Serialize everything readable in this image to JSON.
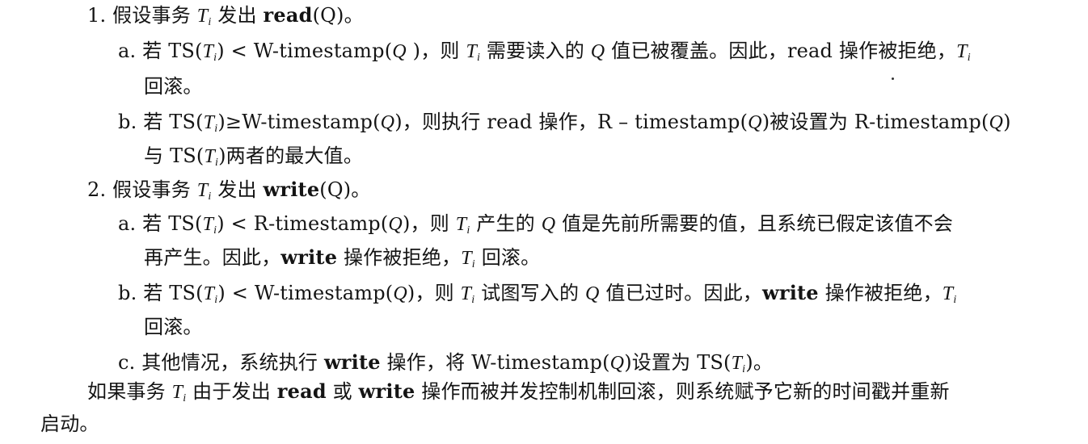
{
  "rules": {
    "r1": {
      "num": "1.",
      "p1": "假设事务 ",
      "T": "T",
      "i": "i",
      "p2": " 发出 ",
      "op": "read",
      "arg": "(Q)。"
    },
    "r1a": {
      "line1_p1": "a. 若 TS(",
      "line1_p2": ") < W-timestamp(",
      "line1_p3": " )，则 ",
      "line1_p4": " 需要读入的 ",
      "line1_p5": " 值已被覆盖。因此，read 操作被拒绝，",
      "line2": "回滚。"
    },
    "r1b": {
      "line1_p1": "b. 若 TS(",
      "line1_p2": ")≥W-timestamp(",
      "line1_p3": ")，则执行 read 操作，R – timestamp(",
      "line1_p4": ")被设置为 R-timestamp(",
      "line1_p5": ")",
      "line2_p1": "与 TS(",
      "line2_p2": ")两者的最大值。"
    },
    "r2": {
      "num": "2.",
      "p1": "假设事务 ",
      "p2": " 发出 ",
      "op": "write",
      "arg": "(Q)。"
    },
    "r2a": {
      "line1_p1": "a. 若 TS(",
      "line1_p2": ") < R-timestamp(",
      "line1_p3": ")，则 ",
      "line1_p4": " 产生的 ",
      "line1_p5": " 值是先前所需要的值，且系统已假定该值不会",
      "line2_p1": "再产生。因此，",
      "line2_op": "write",
      "line2_p2": " 操作被拒绝，",
      "line2_p3": " 回滚。"
    },
    "r2b": {
      "line1_p1": "b. 若 TS(",
      "line1_p2": ") < W-timestamp(",
      "line1_p3": ")，则 ",
      "line1_p4": " 试图写入的 ",
      "line1_p5": " 值已过时。因此，",
      "line1_op": "write",
      "line1_p6": " 操作被拒绝，",
      "line2": "回滚。"
    },
    "r2c": {
      "p1": "c. 其他情况，系统执行 ",
      "op": "write",
      "p2": " 操作，将 W-timestamp(",
      "p3": ")设置为 TS(",
      "p4": ")。"
    }
  },
  "closing": {
    "p1": "如果事务 ",
    "p2": " 由于发出 ",
    "op1": "read",
    "p3": " 或 ",
    "op2": "write",
    "p4": " 操作而被并发控制机制回滚，则系统赋予它新的时间戳并重新",
    "line2": "启动。"
  },
  "vars": {
    "T": "T",
    "i": "i",
    "Q": "Q"
  }
}
